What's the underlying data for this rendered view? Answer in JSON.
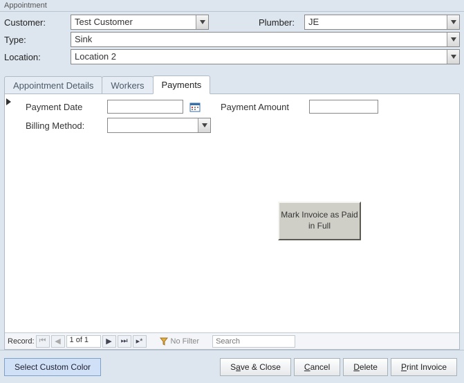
{
  "window_title": "Appointment",
  "header": {
    "customer_label": "Customer:",
    "customer_value": "Test Customer",
    "plumber_label": "Plumber:",
    "plumber_value": "JE",
    "type_label": "Type:",
    "type_value": "Sink",
    "location_label": "Location:",
    "location_value": "Location 2"
  },
  "tabs": {
    "appointment_details": "Appointment Details",
    "workers": "Workers",
    "payments": "Payments"
  },
  "payments": {
    "payment_date_label": "Payment Date",
    "payment_date_value": "",
    "payment_amount_label": "Payment Amount",
    "payment_amount_value": "",
    "billing_method_label": "Billing Method:",
    "billing_method_value": "",
    "mark_paid_button": "Mark Invoice as Paid in Full"
  },
  "record_nav": {
    "label": "Record:",
    "position": "1 of 1",
    "filter_label": "No Filter",
    "search_placeholder": "Search"
  },
  "bottom": {
    "select_color": "Select Custom Color",
    "save_close_pre": "S",
    "save_close_ul": "a",
    "save_close_post": "ve & Close",
    "cancel_ul": "C",
    "cancel_post": "ancel",
    "delete_ul": "D",
    "delete_post": "elete",
    "print_ul": "P",
    "print_post": "rint Invoice"
  }
}
